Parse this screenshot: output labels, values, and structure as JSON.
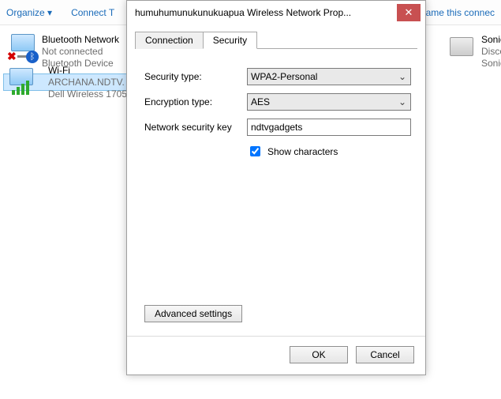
{
  "toolbar": {
    "organize": "Organize ▾",
    "connect_to": "Connect T",
    "rename": "hame this connec"
  },
  "networks": {
    "left": [
      {
        "title": "Bluetooth Network",
        "status": "Not connected",
        "device": "Bluetooth Device"
      },
      {
        "title": "Wi-Fi",
        "status": "ARCHANA.NDTV.",
        "device": "Dell Wireless 1705"
      }
    ],
    "right": [
      {
        "title": "SonicWALL I",
        "status": "Disconnecte",
        "device": "SonicWALL I"
      }
    ]
  },
  "dialog": {
    "title": "humuhumunukunukuapua Wireless Network Prop...",
    "tabs": {
      "connection": "Connection",
      "security": "Security"
    },
    "security": {
      "security_type_label": "Security type:",
      "security_type_value": "WPA2-Personal",
      "encryption_type_label": "Encryption type:",
      "encryption_type_value": "AES",
      "key_label": "Network security key",
      "key_value": "ndtvgadgets",
      "show_chars_label": "Show characters",
      "show_chars_checked": true,
      "advanced": "Advanced settings"
    },
    "buttons": {
      "ok": "OK",
      "cancel": "Cancel"
    }
  }
}
